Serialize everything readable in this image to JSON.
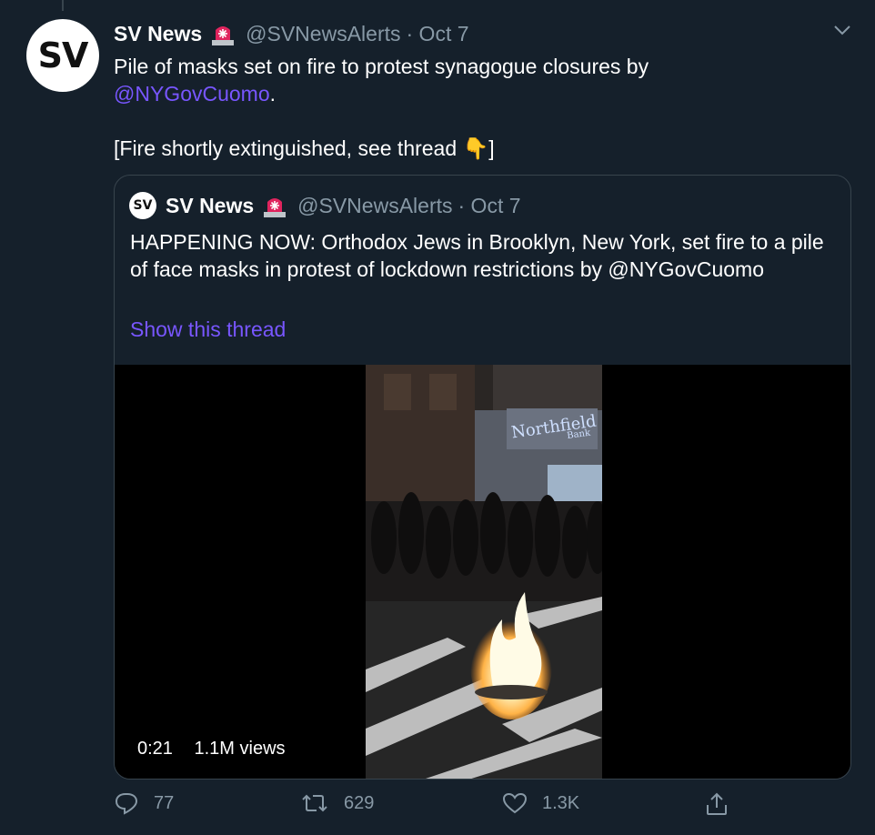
{
  "tweet": {
    "avatar_text": "SV",
    "name": "SV News",
    "handle": "@SVNewsAlerts",
    "date": "· Oct 7",
    "text_line1": "Pile of masks set on fire to protest synagogue closures by",
    "mention": "@NYGovCuomo",
    "mention_suffix": ".",
    "text_line3": "[Fire shortly extinguished, see thread ",
    "pointing_emoji": "👇",
    "text_line3_end": "]"
  },
  "quoted": {
    "avatar_text": "SV",
    "name": "SV News",
    "handle": "@SVNewsAlerts",
    "date": "· Oct 7",
    "text": "HAPPENING NOW: Orthodox Jews in Brooklyn, New York, set fire to a pile of face masks in protest of lockdown restrictions by @NYGovCuomo",
    "show_thread": "Show this thread",
    "video": {
      "duration": "0:21",
      "views": "1.1M views",
      "sign_text": "Northfield",
      "sign_subtext": "Bank"
    }
  },
  "actions": {
    "replies": "77",
    "retweets": "629",
    "likes": "1.3K"
  },
  "colors": {
    "background": "#15202b",
    "link": "#7856ff",
    "muted": "#8899a6",
    "border": "#38444d"
  }
}
